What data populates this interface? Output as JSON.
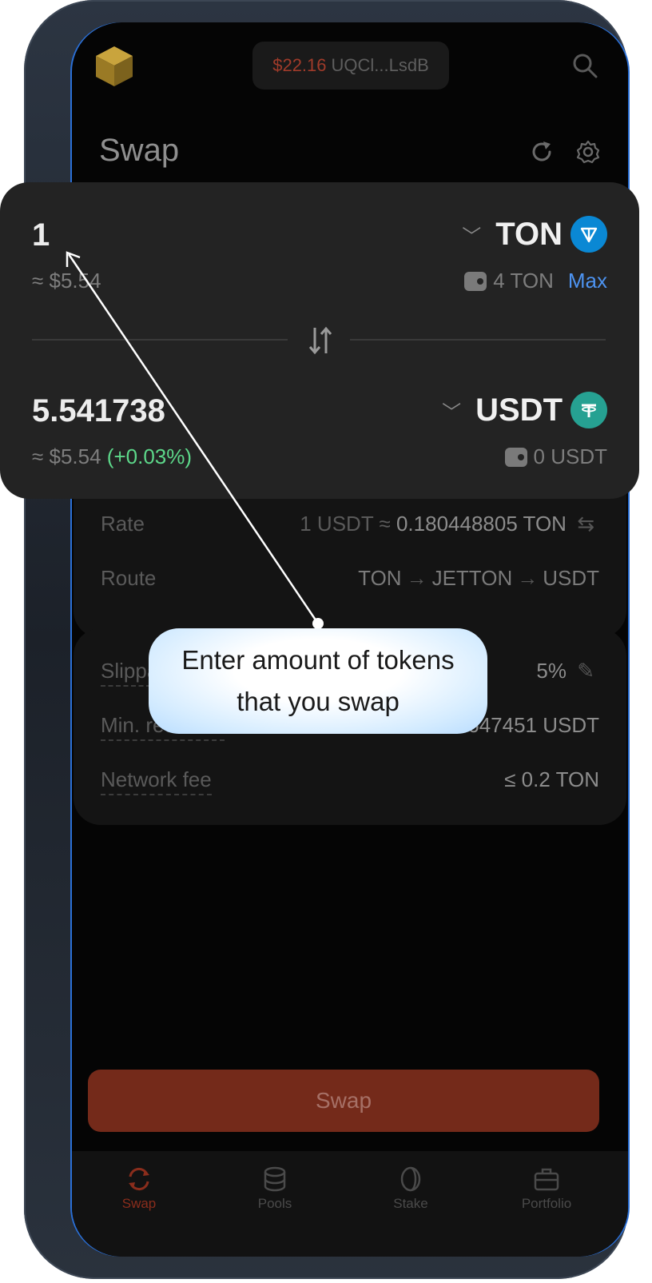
{
  "header": {
    "wallet_balance": "$22.16",
    "wallet_address": "UQCl...LsdB",
    "title": "Swap"
  },
  "swap": {
    "from": {
      "amount": "1",
      "usd": "≈ $5.54",
      "token": "TON",
      "balance": "4 TON",
      "max_label": "Max"
    },
    "to": {
      "amount": "5.541738",
      "usd": "≈ $5.54",
      "change": "(+0.03%)",
      "token": "USDT",
      "balance": "0 USDT"
    }
  },
  "details": {
    "rate_label": "Rate",
    "rate_prefix": "1 USDT ≈",
    "rate_value": "0.180448805 TON",
    "route_label": "Route",
    "route": [
      "TON",
      "JETTON",
      "USDT"
    ],
    "slippage_label": "Slippage",
    "slippage_value": "5%",
    "min_received_label": "Min. received",
    "min_received_value": "5.2647451 USDT",
    "network_fee_label": "Network fee",
    "network_fee_value": "≤ 0.2 TON"
  },
  "swap_button_label": "Swap",
  "tabs": [
    {
      "label": "Swap",
      "icon": "swap-arrows-icon",
      "active": true
    },
    {
      "label": "Pools",
      "icon": "coins-stack-icon",
      "active": false
    },
    {
      "label": "Stake",
      "icon": "coin-icon",
      "active": false
    },
    {
      "label": "Portfolio",
      "icon": "briefcase-icon",
      "active": false
    }
  ],
  "tooltip": {
    "text": "Enter amount of tokens that you swap"
  },
  "colors": {
    "accent": "#742a1a",
    "ton_blue": "#0a88d4",
    "usdt_teal": "#26a192",
    "positive": "#5dd88a",
    "link_blue": "#4d93f0"
  }
}
